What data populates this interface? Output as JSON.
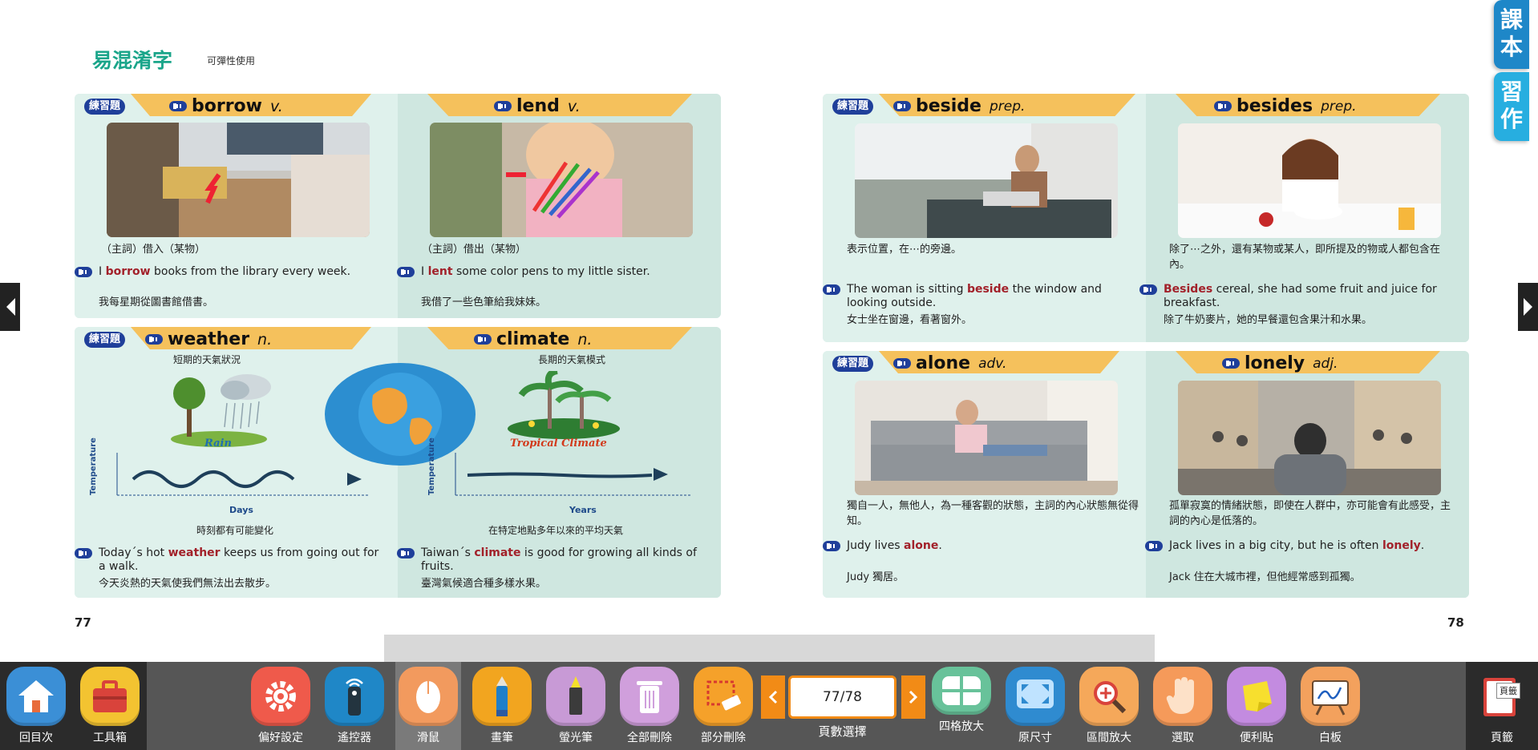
{
  "header": {
    "title": "易混淆字",
    "subtitle": "可彈性使用"
  },
  "side_tabs": [
    "課\n本",
    "習\n作"
  ],
  "pages": {
    "left": "77",
    "right": "78"
  },
  "practice_label": "練習題",
  "cards": {
    "borrow_lend": {
      "left": {
        "word": "borrow",
        "pos": "v.",
        "cn_def": "（主詞）借入（某物）",
        "en_pre": "I ",
        "en_key": "borrow",
        "en_post": " books from the library every week.",
        "cn_trans": "我每星期從圖書館借書。"
      },
      "right": {
        "word": "lend",
        "pos": "v.",
        "cn_def": "（主詞）借出（某物）",
        "en_pre": "I ",
        "en_key": "lent",
        "en_post": " some color pens to my little sister.",
        "cn_trans": "我借了一些色筆給我妹妹。"
      }
    },
    "weather_climate": {
      "left": {
        "word": "weather",
        "pos": "n.",
        "cn_def": "短期的天氣狀況",
        "pic_label": "Rain",
        "graph_y": "Temperature",
        "graph_x": "Days",
        "graph_cn": "時刻都有可能變化",
        "en_pre": "Today´s hot ",
        "en_key": "weather",
        "en_post": " keeps us from going out for a walk.",
        "cn_trans": "今天炎熱的天氣使我們無法出去散步。"
      },
      "right": {
        "word": "climate",
        "pos": "n.",
        "cn_def": "長期的天氣模式",
        "pic_label": "Tropical Climate",
        "graph_y": "Temperature",
        "graph_x": "Years",
        "graph_cn": "在特定地點多年以來的平均天氣",
        "en_pre": "Taiwan´s ",
        "en_key": "climate",
        "en_post": " is good for growing all kinds of fruits.",
        "cn_trans": "臺灣氣候適合種多樣水果。"
      }
    },
    "beside_besides": {
      "left": {
        "word": "beside",
        "pos": "prep.",
        "cn_def": "表示位置，在⋯的旁邊。",
        "en_pre": "The woman is sitting ",
        "en_key": "beside",
        "en_post": " the window and looking outside.",
        "cn_trans": "女士坐在窗邊，看著窗外。"
      },
      "right": {
        "word": "besides",
        "pos": "prep.",
        "cn_def": "除了⋯之外，還有某物或某人，即所提及的物或人都包含在內。",
        "en_pre": "",
        "en_key": "Besides",
        "en_post": " cereal, she had some fruit and juice for breakfast.",
        "cn_trans": "除了牛奶麥片，她的早餐還包含果汁和水果。"
      }
    },
    "alone_lonely": {
      "left": {
        "word": "alone",
        "pos": "adv.",
        "cn_def": "獨自一人，無他人，為一種客觀的狀態，主詞的內心狀態無從得知。",
        "en_pre": "Judy lives ",
        "en_key": "alone",
        "en_post": ".",
        "cn_trans": "Judy 獨居。"
      },
      "right": {
        "word": "lonely",
        "pos": "adj.",
        "cn_def": "孤單寂寞的情緒狀態，即使在人群中，亦可能會有此感受，主詞的內心是低落的。",
        "en_pre": "Jack lives in a big city, but he is often ",
        "en_key": "lonely",
        "en_post": ".",
        "cn_trans": "Jack 住在大城市裡，但他經常感到孤獨。"
      }
    }
  },
  "toolbar": {
    "home": "回目次",
    "toolbox": "工具箱",
    "prefs": "偏好設定",
    "remote": "遙控器",
    "mouse": "滑鼠",
    "pen": "畫筆",
    "highlighter": "螢光筆",
    "delete_all": "全部刪除",
    "delete_part": "部分刪除",
    "page_value": "77/78",
    "page_select": "頁數選擇",
    "four_grid": "四格放大",
    "original": "原尺寸",
    "zoom_area": "區間放大",
    "select": "選取",
    "sticky": "便利貼",
    "whiteboard": "白板",
    "bookmark": "頁籤",
    "bookmark_tag": "頁籤"
  },
  "colors": {
    "teal_title": "#1aa58a",
    "banner": "#f5c15c",
    "keyword": "#a2212a",
    "practice": "#1f3f9a",
    "page_orange": "#f28b16"
  }
}
